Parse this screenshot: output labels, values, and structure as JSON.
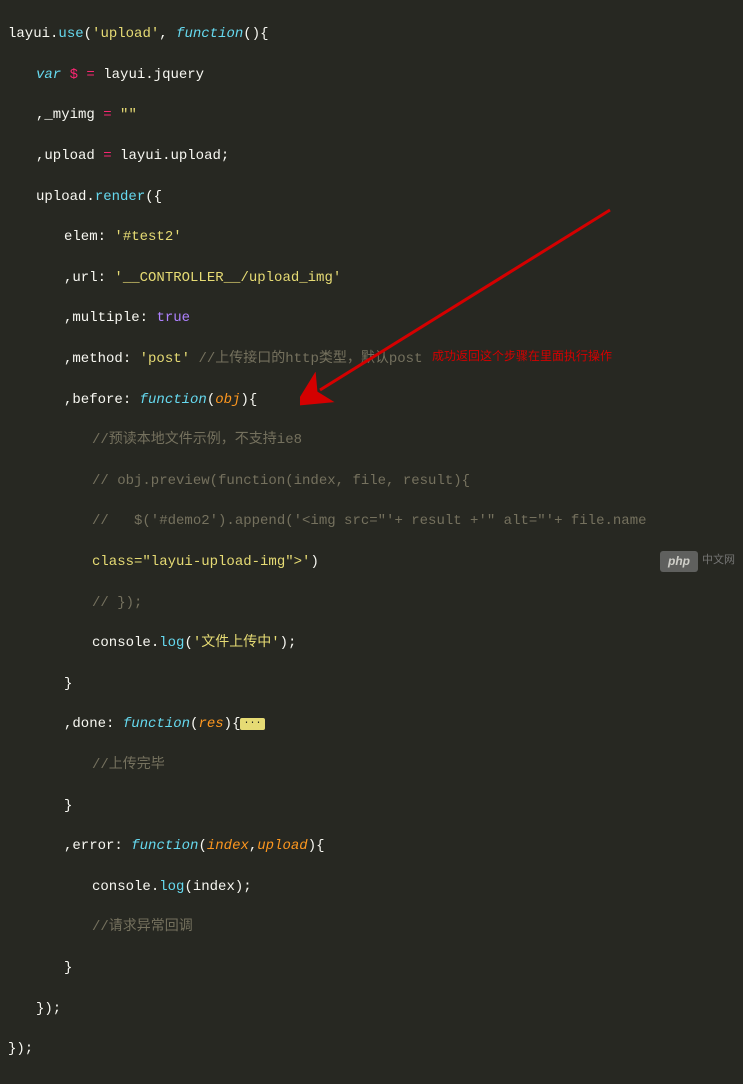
{
  "code": {
    "l1a": "layui",
    "l1b": ".",
    "l1c": "use",
    "l1d": "(",
    "l1e": "'upload'",
    "l1f": ", ",
    "l1g": "function",
    "l1h": "()",
    "l1i": "{",
    "l2a": "var",
    "l2b": " ",
    "l2c": "$",
    "l2d": " = ",
    "l2e": "layui",
    "l2f": ".",
    "l2g": "jquery",
    "l3a": ",",
    "l3b": "_myimg",
    "l3c": " = ",
    "l3d": "\"\"",
    "l4a": ",",
    "l4b": "upload",
    "l4c": " = ",
    "l4d": "layui",
    "l4e": ".",
    "l4f": "upload",
    "l4g": ";",
    "l5a": "upload",
    "l5b": ".",
    "l5c": "render",
    "l5d": "({",
    "l6a": "elem:",
    "l6b": " ",
    "l6c": "'#test2'",
    "l7a": ",",
    "l7b": "url:",
    "l7c": " ",
    "l7d": "'__CONTROLLER__/upload_img'",
    "l8a": ",",
    "l8b": "multiple:",
    "l8c": " ",
    "l8d": "true",
    "l9a": ",",
    "l9b": "method:",
    "l9c": " ",
    "l9d": "'post'",
    "l9e": " ",
    "l9f": "//上传接口的http类型，默认post",
    "l10a": ",",
    "l10b": "before:",
    "l10c": " ",
    "l10d": "function",
    "l10e": "(",
    "l10f": "obj",
    "l10g": ")",
    "l10h": "{",
    "l11": "//预读本地文件示例，不支持ie8",
    "l12": "// obj.preview(function(index, file, result){",
    "l13": "//   $('#demo2').append('<img src=\"'+ result +'\" alt=\"'+ file.name",
    "l14a": "class=\"layui-upload-img\">'",
    "l14b": ")",
    "l15": "// });",
    "l16a": "console",
    "l16b": ".",
    "l16c": "log",
    "l16d": "(",
    "l16e": "'文件上传中'",
    "l16f": ");",
    "l17": "}",
    "l18a": ",",
    "l18b": "done:",
    "l18c": " ",
    "l18d": "function",
    "l18e": "(",
    "l18f": "res",
    "l18g": ")",
    "l18h": "{",
    "l18fold": "···",
    "l19": "//上传完毕",
    "l20": "}",
    "l21a": ",",
    "l21b": "error:",
    "l21c": " ",
    "l21d": "function",
    "l21e": "(",
    "l21f": "index",
    "l21g": ",",
    "l21h": "upload",
    "l21i": ")",
    "l21j": "{",
    "l22a": "console",
    "l22b": ".",
    "l22c": "log",
    "l22d": "(",
    "l22e": "index",
    "l22f": ");",
    "l23": "//请求异常回调",
    "l24": "}",
    "l25": "});",
    "l26": "});"
  },
  "annotation": "成功返回这个步骤在里面执行操作",
  "watermark": {
    "pill": "php",
    "text": "中文网"
  }
}
